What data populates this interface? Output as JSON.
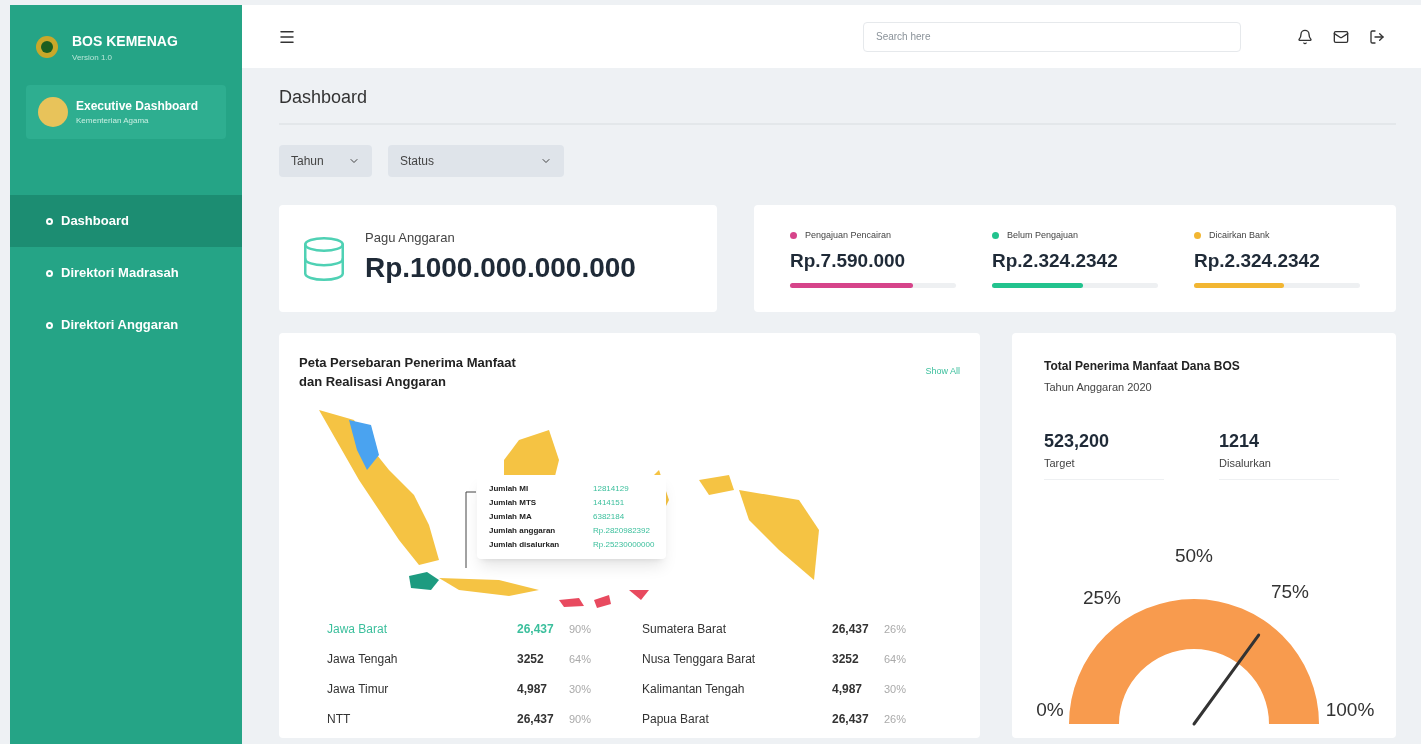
{
  "sidebar": {
    "brand": "BOS KEMENAG",
    "version": "Version 1.0",
    "profile": {
      "title": "Executive Dashboard",
      "subtitle": "Kementerian Agama"
    },
    "items": [
      {
        "label": "Dashboard",
        "selected": true
      },
      {
        "label": "Direktori Madrasah",
        "selected": false
      },
      {
        "label": "Direktori Anggaran",
        "selected": false
      }
    ]
  },
  "header": {
    "search": {
      "placeholder": "Search here"
    }
  },
  "page_title": "Dashboard",
  "filters": [
    {
      "label": "Tahun"
    },
    {
      "label": "Status"
    }
  ],
  "budget": {
    "label": "Pagu Anggaran",
    "value": "Rp.1000.000.000.000"
  },
  "stats": [
    {
      "label": "Pengajuan Pencairan",
      "value": "Rp.7.590.000",
      "color": "#d6448a",
      "level": 0.74
    },
    {
      "label": "Belum Pengajuan",
      "value": "Rp.2.324.2342",
      "color": "#22c38e",
      "level": 0.55
    },
    {
      "label": "Dicairkan Bank",
      "value": "Rp.2.324.2342",
      "color": "#f2b632",
      "level": 0.54
    }
  ],
  "map_card": {
    "title": "Peta Persebaran Penerima Manfaat dan Realisasi Anggaran",
    "link": "Show All",
    "tooltip": [
      {
        "label": "Jumlah MI",
        "value": "12814129"
      },
      {
        "label": "Jumlah MTS",
        "value": "1414151"
      },
      {
        "label": "Jumlah MA",
        "value": "6382184"
      },
      {
        "label": "Jumlah anggaran",
        "value": "Rp.2820982392"
      },
      {
        "label": "Jumlah disalurkan",
        "value": "Rp.25230000000"
      }
    ],
    "regions": [
      {
        "name": "Jawa Barat",
        "count": "26,437",
        "percent": "90%",
        "selected": true
      },
      {
        "name": "Sumatera Barat",
        "count": "26,437",
        "percent": "26%",
        "selected": false
      },
      {
        "name": "Jawa Tengah",
        "count": "3252",
        "percent": "64%",
        "selected": false
      },
      {
        "name": "Nusa Tenggara Barat",
        "count": "3252",
        "percent": "64%",
        "selected": false
      },
      {
        "name": "Jawa Timur",
        "count": "4,987",
        "percent": "30%",
        "selected": false
      },
      {
        "name": "Kalimantan Tengah",
        "count": "4,987",
        "percent": "30%",
        "selected": false
      },
      {
        "name": "NTT",
        "count": "26,437",
        "percent": "90%",
        "selected": false
      },
      {
        "name": "Papua Barat",
        "count": "26,437",
        "percent": "26%",
        "selected": false
      }
    ]
  },
  "total_card": {
    "title": "Total Penerima Manfaat Dana BOS",
    "subtitle": "Tahun Anggaran 2020",
    "figures": [
      {
        "value": "523,200",
        "label": "Target"
      },
      {
        "value": "1214",
        "label": "Disalurkan"
      }
    ],
    "gauge": {
      "labels": [
        "0%",
        "25%",
        "50%",
        "75%",
        "100%"
      ],
      "level": 0.7
    }
  }
}
